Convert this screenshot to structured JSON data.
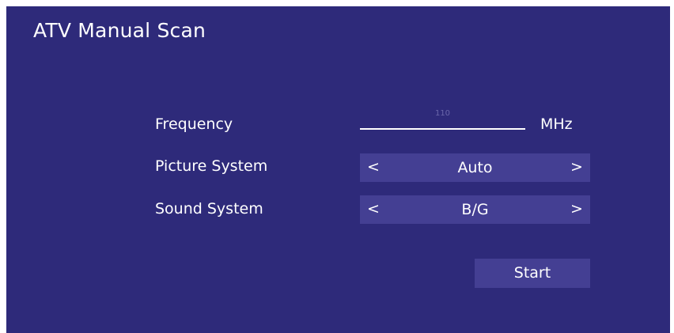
{
  "screen": {
    "title": "ATV Manual Scan"
  },
  "frequency": {
    "label": "Frequency",
    "value": "110",
    "unit": "MHz"
  },
  "picture_system": {
    "label": "Picture System",
    "value": "Auto",
    "left_arrow": "<",
    "right_arrow": ">"
  },
  "sound_system": {
    "label": "Sound System",
    "value": "B/G",
    "left_arrow": "<",
    "right_arrow": ">"
  },
  "start_button": {
    "label": "Start"
  },
  "colors": {
    "background": "#2e2a7a",
    "field_background": "#443f93",
    "text": "#ffffff"
  }
}
